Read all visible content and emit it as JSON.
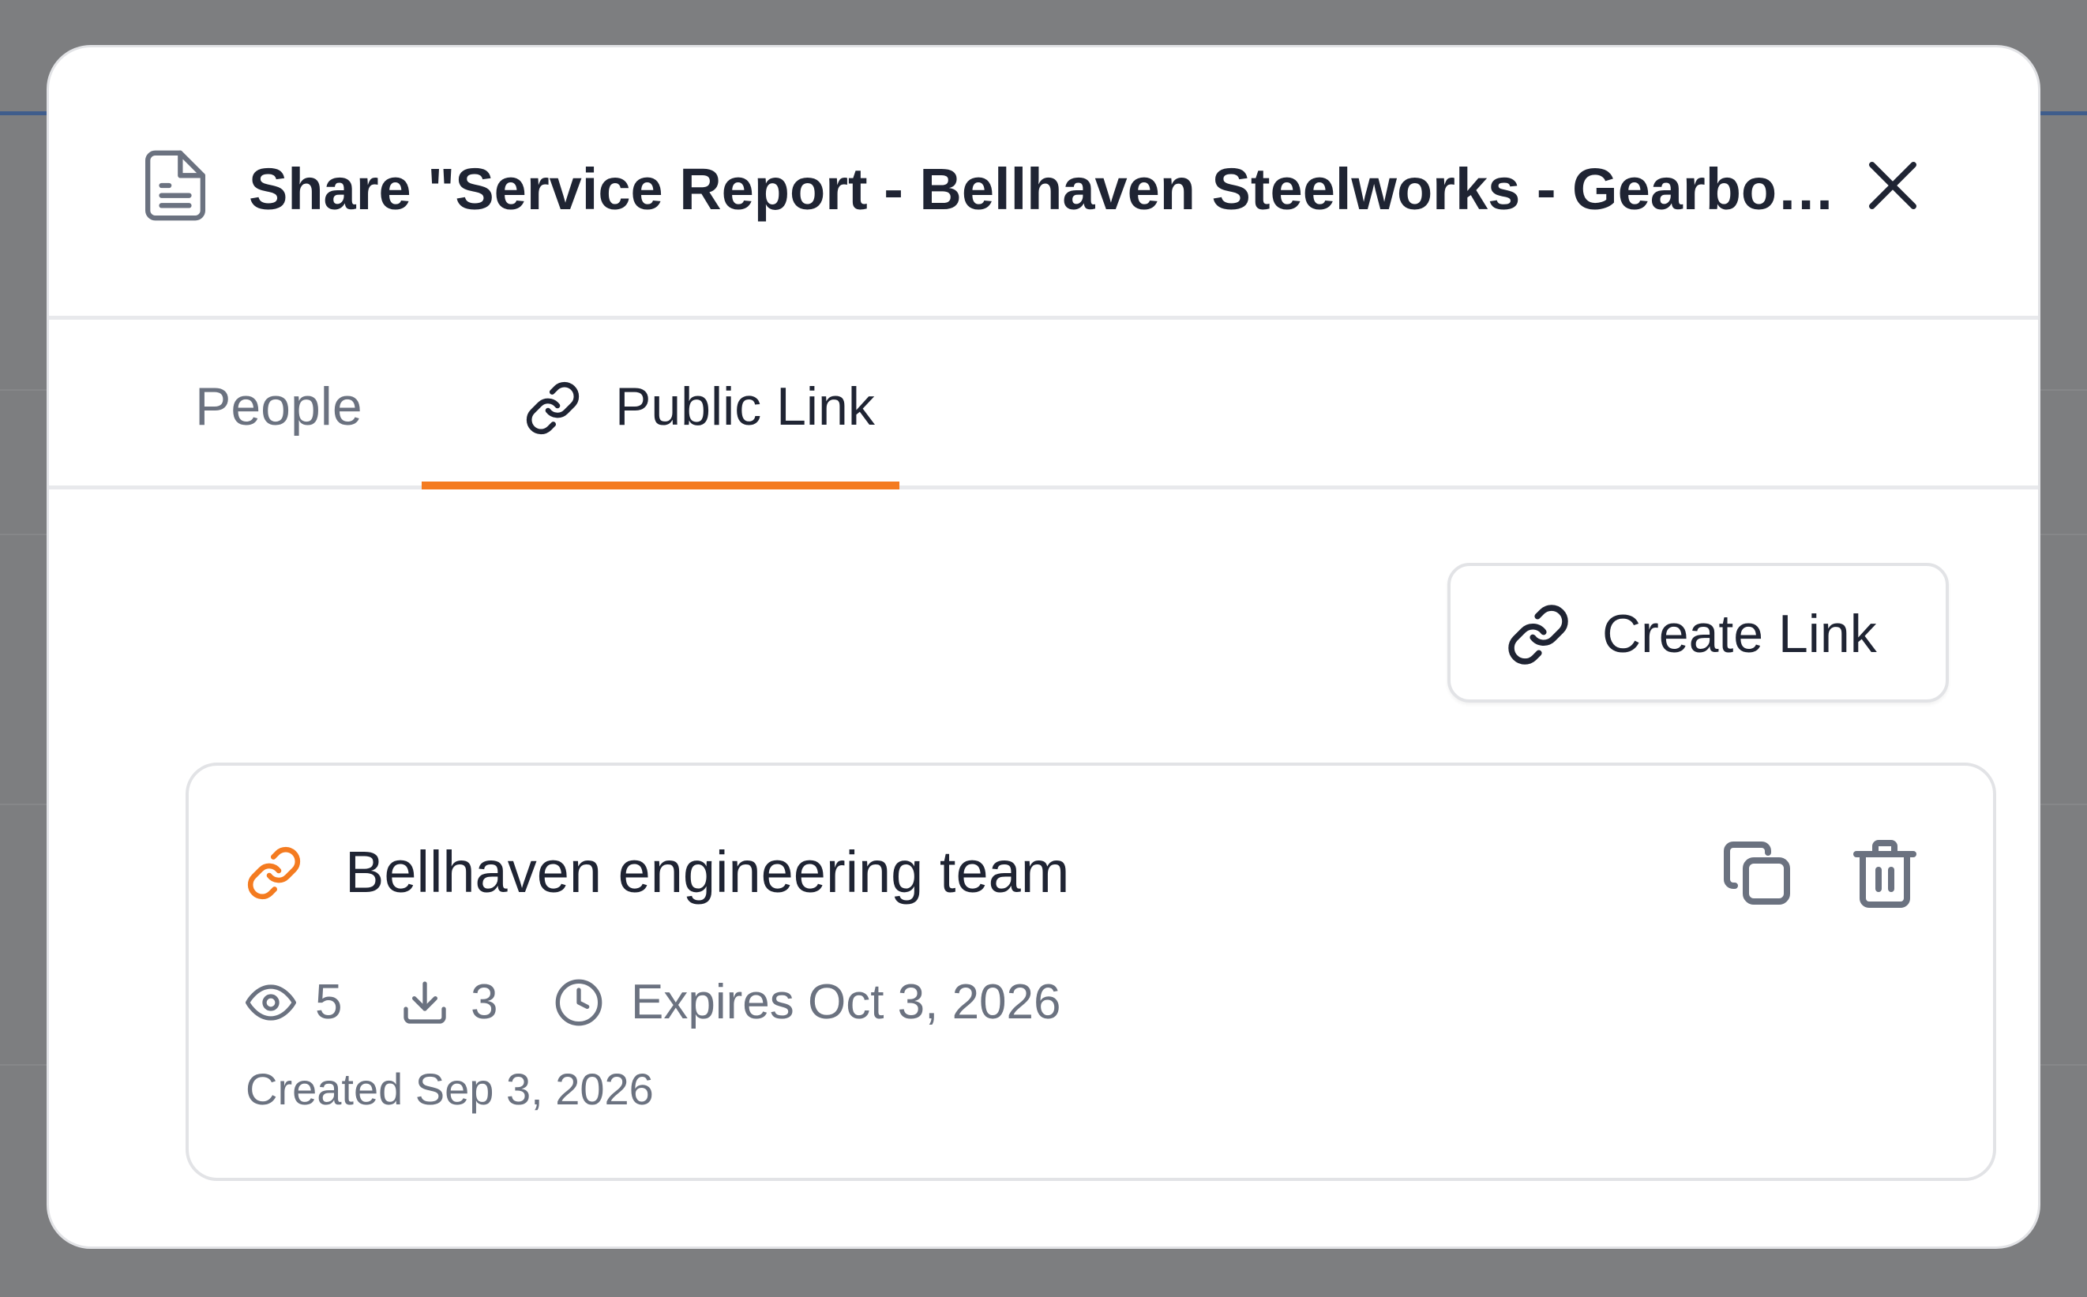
{
  "dialog": {
    "title": "Share \"Service Report - Bellhaven Steelworks - Gearbox Vibration Analysis\"",
    "doc_icon": "document-icon",
    "close_icon": "close-icon"
  },
  "tabs": [
    {
      "label": "People",
      "active": false
    },
    {
      "label": "Public Link",
      "active": true,
      "icon": "link-icon"
    }
  ],
  "create_link": {
    "label": "Create Link",
    "icon": "link-icon"
  },
  "links": [
    {
      "name": "Bellhaven engineering team",
      "icon": "link-icon",
      "views": "5",
      "downloads": "3",
      "expires": "Expires Oct 3, 2026",
      "created": "Created Sep 3, 2026",
      "actions": [
        "copy-icon",
        "trash-icon"
      ]
    }
  ],
  "colors": {
    "accent": "#f47b20",
    "text_primary": "#1f2433",
    "text_muted": "#6b7280",
    "border": "#e2e3e6",
    "backdrop": "#7d7e80"
  }
}
